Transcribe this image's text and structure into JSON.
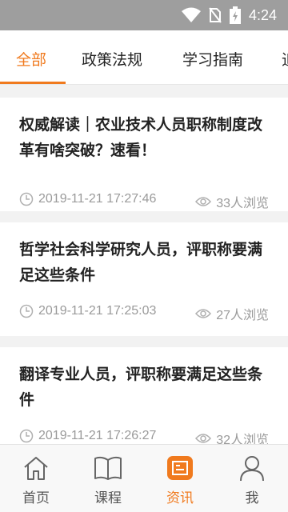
{
  "status_bar": {
    "time": "4:24"
  },
  "tabs": [
    {
      "label": "全部"
    },
    {
      "label": "政策法规"
    },
    {
      "label": "学习指南"
    },
    {
      "label": "追"
    }
  ],
  "articles": [
    {
      "title": "权威解读｜农业技术人员职称制度改革有啥突破？速看！",
      "datetime": "2019-11-21 17:27:46",
      "views": "33人浏览"
    },
    {
      "title": "哲学社会科学研究人员，评职称要满足这些条件",
      "datetime": "2019-11-21 17:25:03",
      "views": "27人浏览"
    },
    {
      "title": "翻译专业人员，评职称要满足这些条件",
      "datetime": "2019-11-21 17:26:27",
      "views": "32人浏览"
    }
  ],
  "bottom_nav": [
    {
      "label": "首页",
      "icon": "home-icon"
    },
    {
      "label": "课程",
      "icon": "book-icon"
    },
    {
      "label": "资讯",
      "icon": "news-icon"
    },
    {
      "label": "我",
      "icon": "user-icon"
    }
  ],
  "colors": {
    "accent": "#f07a1e",
    "status_bar": "#9e9e9e"
  }
}
